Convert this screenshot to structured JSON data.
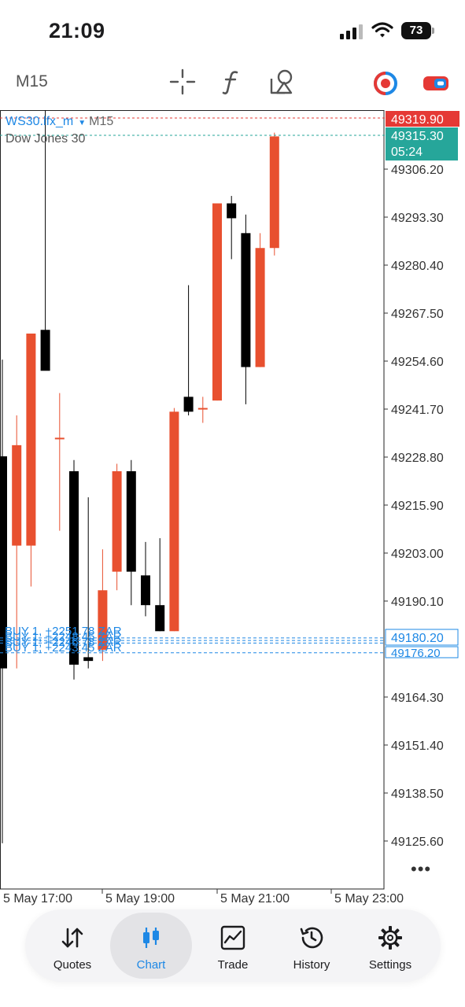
{
  "status_bar": {
    "time": "21:09",
    "battery": "73"
  },
  "toolbar": {
    "timeframe": "M15",
    "icons": [
      "crosshair-icon",
      "function-icon",
      "objects-icon",
      "one-click-trading-icon",
      "toggle-icon"
    ]
  },
  "chart": {
    "symbol": "WS30.lfx_m",
    "timeframe": "M15",
    "description": "Dow Jones 30",
    "ask_price": "49319.90",
    "bid_price": "49315.30",
    "bar_countdown": "05:24",
    "price_axis": [
      "49306.20",
      "49293.30",
      "49280.40",
      "49267.50",
      "49254.60",
      "49241.70",
      "49228.80",
      "49215.90",
      "49203.00",
      "49190.10",
      "49164.30",
      "49151.40",
      "49138.50",
      "49125.60"
    ],
    "position_price_top": "49180.20",
    "position_price_bottom": "49176.20",
    "position_labels": [
      "BUY 1, +2251.78 ZAR",
      "BUY 1, +2248.45 ZAR",
      "BUY 1, +2246.78 ZAR",
      "BUY 1, +2243.45 ZAR"
    ],
    "time_axis": [
      "5 May 17:00",
      "5 May 19:00",
      "5 May 21:00",
      "5 May 23:00"
    ],
    "more": "•••",
    "colors": {
      "bull": "#e8502f",
      "bear": "#000000",
      "ask_line": "#e53935",
      "bid_line": "#26a69a",
      "position": "#1e88e5"
    }
  },
  "chart_data": {
    "type": "candlestick",
    "symbol": "WS30.lfx_m",
    "timeframe": "M15",
    "candles": [
      {
        "o": 49229,
        "h": 49255,
        "l": 49125,
        "c": 49172
      },
      {
        "o": 49205,
        "h": 49240,
        "l": 49172,
        "c": 49232
      },
      {
        "o": 49205,
        "h": 49262,
        "l": 49194,
        "c": 49262
      },
      {
        "o": 49263,
        "h": 49324,
        "l": 49254,
        "c": 49252
      },
      {
        "o": 49234,
        "h": 49246,
        "l": 49209,
        "c": 49234
      },
      {
        "o": 49225,
        "h": 49228,
        "l": 49169,
        "c": 49173
      },
      {
        "o": 49175,
        "h": 49218,
        "l": 49172,
        "c": 49174
      },
      {
        "o": 49177,
        "h": 49204,
        "l": 49174,
        "c": 49193
      },
      {
        "o": 49198,
        "h": 49227,
        "l": 49193,
        "c": 49225
      },
      {
        "o": 49225,
        "h": 49228,
        "l": 49189,
        "c": 49198
      },
      {
        "o": 49197,
        "h": 49206,
        "l": 49186,
        "c": 49189
      },
      {
        "o": 49189,
        "h": 49207,
        "l": 49182,
        "c": 49182
      },
      {
        "o": 49182,
        "h": 49242,
        "l": 49182,
        "c": 49241
      },
      {
        "o": 49245,
        "h": 49275,
        "l": 49240,
        "c": 49241
      },
      {
        "o": 49242,
        "h": 49245,
        "l": 49238,
        "c": 49242
      },
      {
        "o": 49244,
        "h": 49297,
        "l": 49244,
        "c": 49297
      },
      {
        "o": 49297,
        "h": 49299,
        "l": 49282,
        "c": 49293
      },
      {
        "o": 49289,
        "h": 49294,
        "l": 49243,
        "c": 49253
      },
      {
        "o": 49253,
        "h": 49289,
        "l": 49253,
        "c": 49285
      },
      {
        "o": 49285,
        "h": 49316,
        "l": 49283,
        "c": 49315
      }
    ],
    "ask": 49319.9,
    "bid": 49315.3,
    "positions": [
      49180.2,
      49179.5,
      49178.8,
      49176.2
    ]
  },
  "nav": {
    "items": [
      {
        "label": "Quotes",
        "icon": "quotes-icon"
      },
      {
        "label": "Chart",
        "icon": "chart-icon"
      },
      {
        "label": "Trade",
        "icon": "trade-icon"
      },
      {
        "label": "History",
        "icon": "history-icon"
      },
      {
        "label": "Settings",
        "icon": "settings-icon"
      }
    ],
    "active": "Chart"
  }
}
